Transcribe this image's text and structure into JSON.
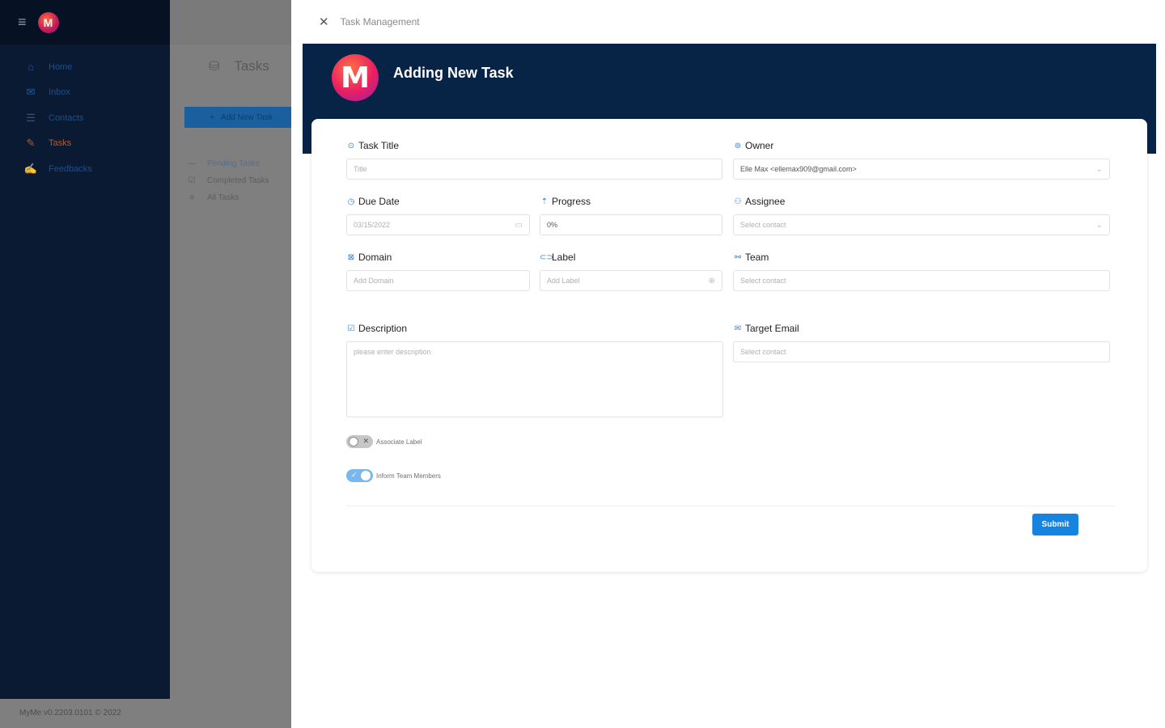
{
  "sidebar": {
    "items": [
      {
        "label": "Home",
        "icon": "home-icon",
        "glyph": "⌂"
      },
      {
        "label": "Inbox",
        "icon": "mail-icon",
        "glyph": "✉"
      },
      {
        "label": "Contacts",
        "icon": "contacts-icon",
        "glyph": "☰"
      },
      {
        "label": "Tasks",
        "icon": "tasks-icon",
        "glyph": "✎"
      },
      {
        "label": "Feedbacks",
        "icon": "feedback-icon",
        "glyph": "✍"
      }
    ],
    "active": "Tasks",
    "version": "MyMe v0.2203.0101 © 2022"
  },
  "main": {
    "title": "Tasks",
    "add_button": "Add New Task",
    "task_lists": [
      {
        "label": "Pending Tasks",
        "icon": "pending-icon",
        "glyph": "—"
      },
      {
        "label": "Completed Tasks",
        "icon": "completed-icon",
        "glyph": "☑"
      },
      {
        "label": "All Tasks",
        "icon": "all-tasks-icon",
        "glyph": "≡"
      }
    ]
  },
  "drawer": {
    "title": "Task Management",
    "heading": "Adding New Task",
    "logo_letter": "M"
  },
  "form": {
    "task_title": {
      "label": "Task Title",
      "placeholder": "Title"
    },
    "owner": {
      "label": "Owner",
      "value": "Elle Max <ellemax909@gmail.com>"
    },
    "due_date": {
      "label": "Due Date",
      "value": "03/15/2022"
    },
    "progress": {
      "label": "Progress",
      "value": "0%"
    },
    "assignee": {
      "label": "Assignee",
      "placeholder": "Select contact"
    },
    "domain": {
      "label": "Domain",
      "placeholder": "Add Domain"
    },
    "label_field": {
      "label": "Label",
      "placeholder": "Add Label"
    },
    "team": {
      "label": "Team",
      "placeholder": "Select contact"
    },
    "description": {
      "label": "Description",
      "placeholder": "please enter description"
    },
    "target_email": {
      "label": "Target Email",
      "placeholder": "Select contact"
    },
    "toggles": [
      {
        "label": "Associate Label",
        "on": false
      },
      {
        "label": "Inform Team Members",
        "on": true
      }
    ],
    "submit": "Submit"
  },
  "colors": {
    "brand_navy": "#072346",
    "primary_blue": "#1783e0",
    "active_nav": "#b35a32"
  }
}
